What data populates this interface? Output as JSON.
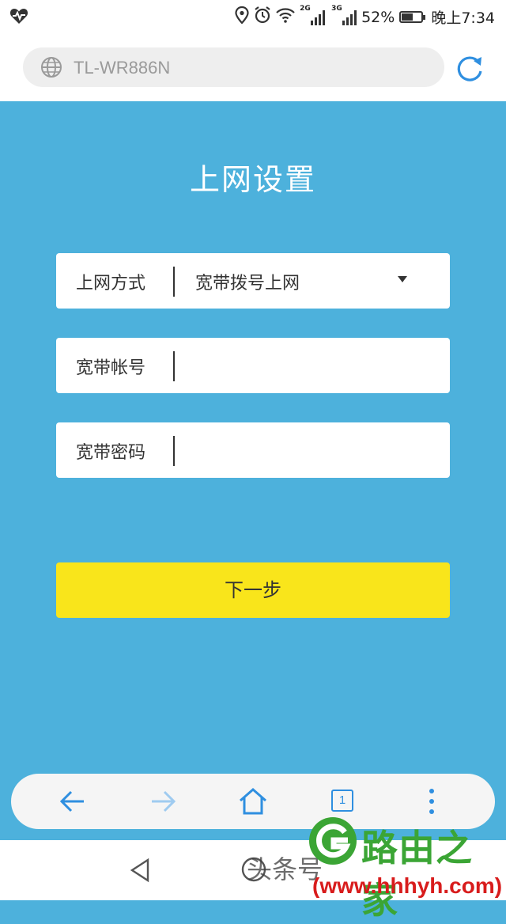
{
  "status_bar": {
    "battery": "52%",
    "time": "晚上7:34",
    "network_2g": "2G",
    "network_3g": "3G",
    "battery_level": 0.52
  },
  "browser": {
    "url": "TL-WR886N",
    "tab_count": "1"
  },
  "page": {
    "title": "上网设置",
    "form": {
      "connection_type_label": "上网方式",
      "connection_type_value": "宽带拨号上网",
      "account_label": "宽带帐号",
      "account_value": "",
      "password_label": "宽带密码",
      "password_value": ""
    },
    "next_button": "下一步"
  },
  "watermark": {
    "source": "头条号",
    "brand": "路由之家",
    "url": "(www.hhhyh.com)"
  },
  "colors": {
    "background": "#4db1dc",
    "button": "#f9e51b",
    "accent": "#2f8fe0",
    "brand_green": "#3ba535",
    "brand_red": "#d81c1c"
  },
  "icons": [
    "heart-rate-icon",
    "location-icon",
    "alarm-icon",
    "wifi-icon",
    "signal-icon",
    "battery-icon",
    "globe-icon",
    "reload-icon",
    "dropdown-arrow-icon",
    "back-arrow-icon",
    "forward-arrow-icon",
    "home-icon",
    "tabs-icon",
    "more-menu-icon",
    "nav-back-icon",
    "nav-home-icon"
  ]
}
